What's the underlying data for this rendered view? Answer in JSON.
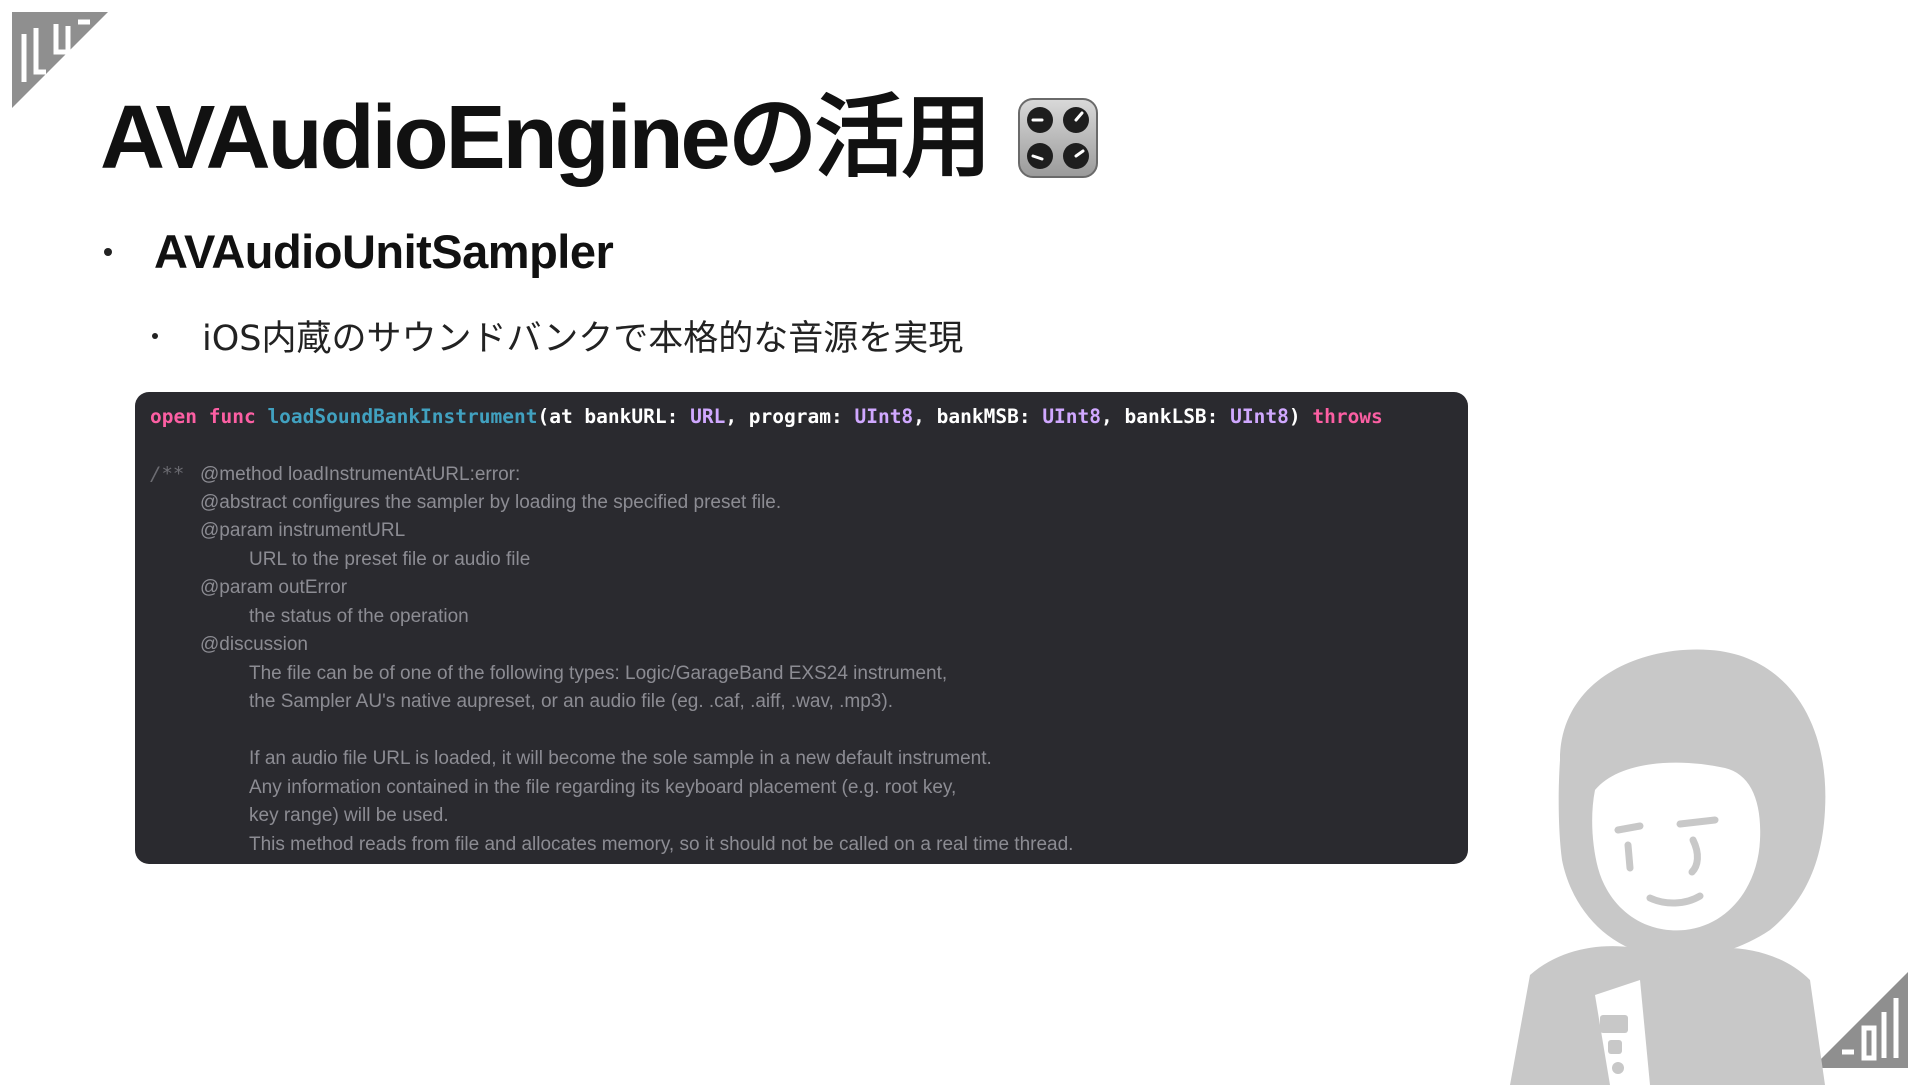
{
  "title": {
    "text": "AVAudioEngineの活用",
    "icon": "control-knobs-icon"
  },
  "bullets": [
    {
      "text": "AVAudioUnitSampler",
      "level": 1
    },
    {
      "text": "iOS内蔵のサウンドバンクで本格的な音源を実現",
      "level": 2
    }
  ],
  "code": {
    "signature": {
      "kw_open": "open",
      "kw_func": "func",
      "fn_name": "loadSoundBankInstrument",
      "p1": "(at bankURL: ",
      "t1": "URL",
      "p2": ", program: ",
      "t2": "UInt8",
      "p3": ", bankMSB: ",
      "t3": "UInt8",
      "p4": ", bankLSB: ",
      "t4": "UInt8",
      "p5": ") ",
      "kw_throws": "throws"
    },
    "comment_marker": "/**",
    "doc_lines": [
      "@method loadInstrumentAtURL:error:",
      "@abstract configures the sampler by loading the specified preset file.",
      "@param instrumentURL",
      "URL to the preset file or audio file",
      "@param outError",
      "the status of the operation",
      "@discussion",
      "The file can be of one of the following types: Logic/GarageBand EXS24 instrument,",
      "the Sampler AU's native aupreset, or an audio file (eg. .caf, .aiff, .wav, .mp3).",
      "If an audio file URL is loaded, it will become the sole sample in a new default instrument.",
      "Any information contained in the file regarding its keyboard placement (e.g. root key,",
      "key range) will be used.",
      "This method reads from file and allocates memory, so it should not be called on a real time thread."
    ]
  },
  "colors": {
    "background": "#ffffff",
    "code_background": "#2a2a2f",
    "keyword": "#fc5fa3",
    "function_name": "#41a1c0",
    "type": "#d0a8ff",
    "comment": "#8c8c93",
    "avatar": "#c8c8c8"
  },
  "decorations": [
    "corner-logo-top-left",
    "corner-logo-bottom-right",
    "avatar-illustration"
  ]
}
